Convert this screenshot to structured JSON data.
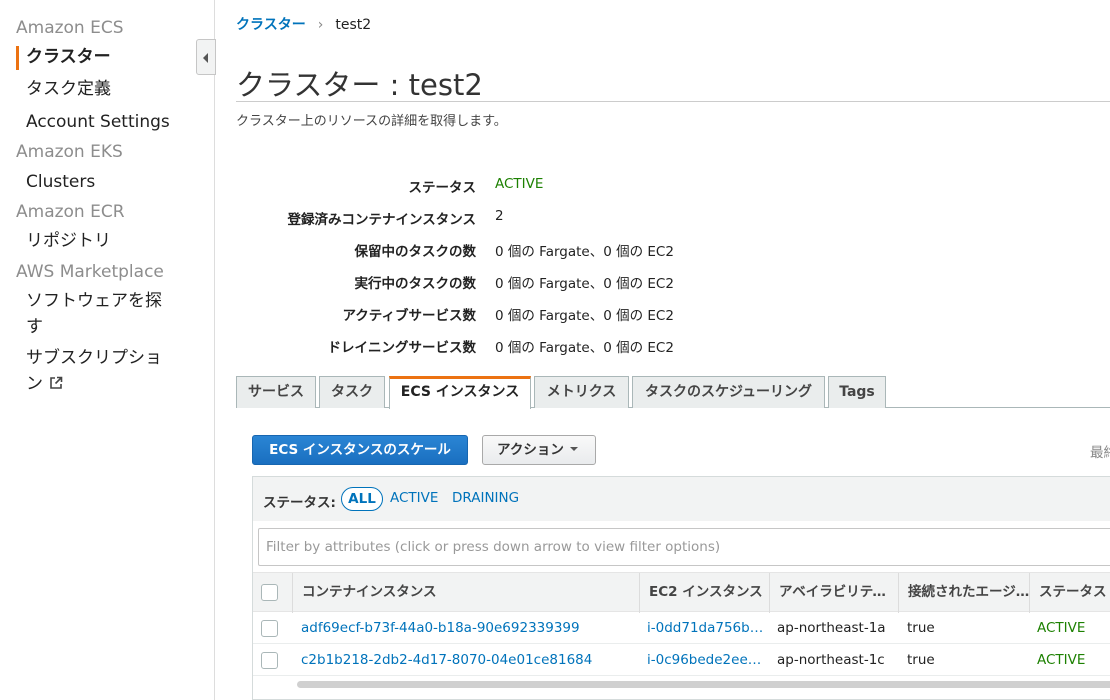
{
  "sidebar": {
    "groups": [
      "Amazon ECS",
      "Amazon EKS",
      "Amazon ECR",
      "AWS Marketplace"
    ],
    "items": {
      "clusters": "クラスター",
      "task_definitions": "タスク定義",
      "account_settings": "Account Settings",
      "eks_clusters": "Clusters",
      "repositories": "リポジトリ",
      "discover_software": "ソフトウェアを探す",
      "subscriptions": "サブスクリプション"
    }
  },
  "breadcrumb": {
    "root": "クラスター",
    "separator": "›",
    "current": "test2"
  },
  "page": {
    "title": "クラスター : test2",
    "description": "クラスター上のリソースの詳細を取得します。"
  },
  "details": [
    {
      "label": "ステータス",
      "value": "ACTIVE"
    },
    {
      "label": "登録済みコンテナインスタンス",
      "value": "2"
    },
    {
      "label": "保留中のタスクの数",
      "value": "0 個の Fargate、0 個の EC2"
    },
    {
      "label": "実行中のタスクの数",
      "value": "0 個の Fargate、0 個の EC2"
    },
    {
      "label": "アクティブサービス数",
      "value": "0 個の Fargate、0 個の EC2"
    },
    {
      "label": "ドレイニングサービス数",
      "value": "0 個の Fargate、0 個の EC2"
    }
  ],
  "tabs": [
    "サービス",
    "タスク",
    "ECS インスタンス",
    "メトリクス",
    "タスクのスケジューリング",
    "Tags"
  ],
  "selected_tab": "ECS インスタンス",
  "toolbar": {
    "scale_button": "ECS インスタンスのスケール",
    "actions_button": "アクション",
    "right_clipped": "最終"
  },
  "filter": {
    "status_label": "ステータス:",
    "all": "ALL",
    "active": "ACTIVE",
    "draining": "DRAINING",
    "placeholder": "Filter by attributes (click or press down arrow to view filter options)"
  },
  "table": {
    "columns": [
      "コンテナインスタンス",
      "EC2 インスタンス",
      "アベイラビリティーゾーン",
      "接続されたエージェント",
      "ステータス"
    ],
    "rows": [
      {
        "instance": "adf69ecf-b73f-44a0-b18a-90e692339399",
        "ec2": "i-0dd71da756b…",
        "az": "ap-northeast-1a",
        "agent": "true",
        "status": "ACTIVE"
      },
      {
        "instance": "c2b1b218-2db2-4d17-8070-04e01ce81684",
        "ec2": "i-0c96bede2ee…",
        "az": "ap-northeast-1c",
        "agent": "true",
        "status": "ACTIVE"
      }
    ]
  },
  "colors": {
    "link": "#0073bb",
    "active_green": "#1d8102",
    "accent_orange": "#ec7211",
    "primary_button": "#1a6fc0"
  }
}
